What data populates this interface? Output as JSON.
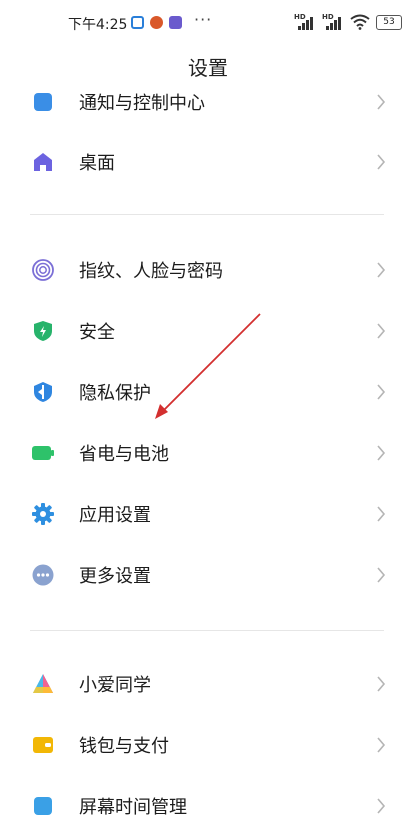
{
  "status_bar": {
    "time": "下午4:25",
    "battery": "53",
    "app_icon_colors": [
      "#2a7fd9",
      "#d9582a",
      "#6a5acd"
    ],
    "dots": "···"
  },
  "header": {
    "title": "设置"
  },
  "groups": [
    {
      "items": [
        {
          "label": "通知与控制中心",
          "icon": "notification-icon",
          "color": "#3a8ee6"
        },
        {
          "label": "桌面",
          "icon": "home-icon",
          "color": "#6c63e0"
        }
      ]
    },
    {
      "items": [
        {
          "label": "指纹、人脸与密码",
          "icon": "fingerprint-icon",
          "color": "#7b6fd6"
        },
        {
          "label": "安全",
          "icon": "shield-icon",
          "color": "#27b36b"
        },
        {
          "label": "隐私保护",
          "icon": "privacy-icon",
          "color": "#2f86e0"
        },
        {
          "label": "省电与电池",
          "icon": "battery-icon",
          "color": "#2ec26a"
        },
        {
          "label": "应用设置",
          "icon": "gear-icon",
          "color": "#2e8fe0"
        },
        {
          "label": "更多设置",
          "icon": "more-icon",
          "color": "#8aa2cf"
        }
      ]
    },
    {
      "items": [
        {
          "label": "小爱同学",
          "icon": "xiaoai-icon",
          "color": "#4ab8e8"
        },
        {
          "label": "钱包与支付",
          "icon": "wallet-icon",
          "color": "#f2b705"
        },
        {
          "label": "屏幕时间管理",
          "icon": "screen-time-icon",
          "color": "#3aa0e6"
        }
      ]
    }
  ]
}
